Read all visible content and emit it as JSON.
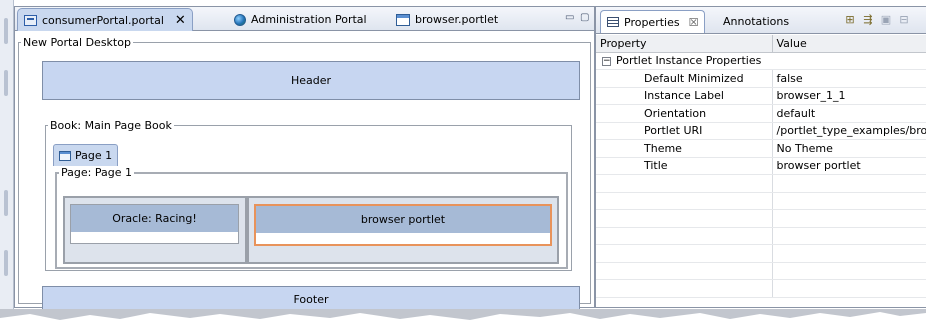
{
  "editor": {
    "tabs": [
      {
        "label": "consumerPortal.portal",
        "icon": "portal-file-icon",
        "active": true,
        "close": "✕"
      },
      {
        "label": "Administration Portal",
        "icon": "globe-icon",
        "active": false
      },
      {
        "label": "browser.portlet",
        "icon": "portlet-file-icon",
        "active": false
      }
    ],
    "desktop_legend": "New Portal Desktop",
    "header_label": "Header",
    "book_legend": "Book: Main Page Book",
    "page_tab_label": "Page 1",
    "page_legend": "Page: Page 1",
    "portlets": [
      {
        "title": "Oracle: Racing!",
        "selected": false
      },
      {
        "title": "browser portlet",
        "selected": true
      }
    ],
    "footer_label": "Footer"
  },
  "properties": {
    "tabs": [
      {
        "label": "Properties",
        "icon": "properties-icon",
        "active": true,
        "close": "☒"
      },
      {
        "label": "Annotations",
        "active": false
      }
    ],
    "columns": [
      "Property",
      "Value"
    ],
    "group": {
      "label": "Portlet Instance Properties",
      "toggle": "−"
    },
    "rows": [
      {
        "property": "Default Minimized",
        "value": "false"
      },
      {
        "property": "Instance Label",
        "value": "browser_1_1"
      },
      {
        "property": "Orientation",
        "value": "default"
      },
      {
        "property": "Portlet URI",
        "value": "/portlet_type_examples/bro"
      },
      {
        "property": "Theme",
        "value": "No Theme"
      },
      {
        "property": "Title",
        "value": "browser portlet"
      }
    ]
  },
  "colors": {
    "accent_selected": "#e8935b",
    "bar_blue": "#c7d6f1",
    "portlet_title": "#a6bad6"
  }
}
